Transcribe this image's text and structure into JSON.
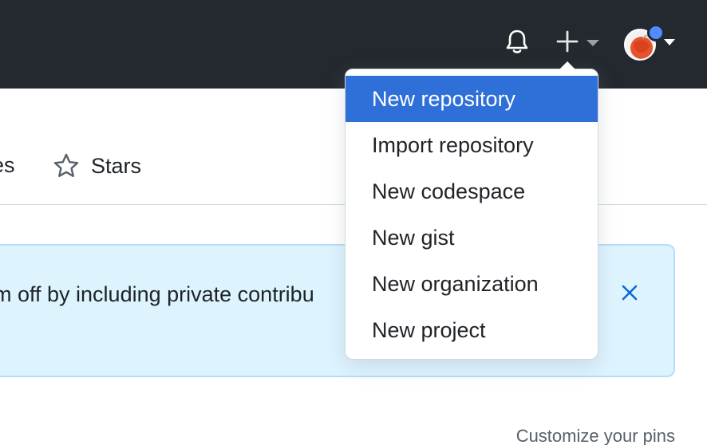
{
  "header": {
    "background": "#24292f",
    "icons": [
      "bell-icon",
      "plus-icon",
      "caret-down-icon",
      "avatar"
    ],
    "notification_dot_color": "#4e8cff"
  },
  "tabs": {
    "partial_label": "es",
    "stars_label": "Stars"
  },
  "banner": {
    "text": "m off by including private contribu",
    "background": "#ddf4ff"
  },
  "customize_pins_label": "Customize your pins",
  "dropdown": {
    "items": [
      {
        "label": "New repository",
        "highlighted": true
      },
      {
        "label": "Import repository"
      },
      {
        "label": "New codespace"
      },
      {
        "label": "New gist"
      },
      {
        "label": "New organization"
      },
      {
        "label": "New project"
      }
    ],
    "highlight_color": "#2f6fd8"
  }
}
